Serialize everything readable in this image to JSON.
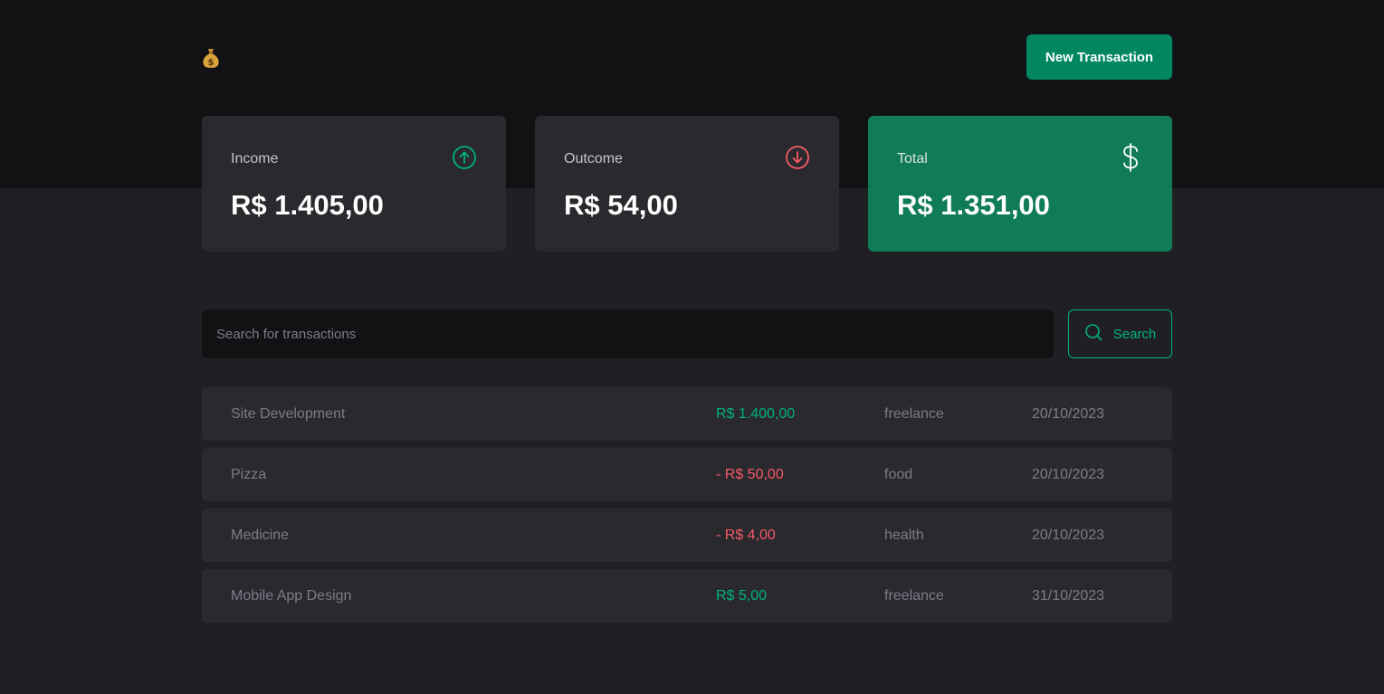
{
  "header": {
    "logo_icon": "money-bag-icon",
    "new_transaction_label": "New Transaction"
  },
  "summary": {
    "income": {
      "label": "Income",
      "value": "R$ 1.405,00",
      "icon": "arrow-circle-up-icon",
      "icon_color": "#00b37e"
    },
    "outcome": {
      "label": "Outcome",
      "value": "R$ 54,00",
      "icon": "arrow-circle-down-icon",
      "icon_color": "#f75a68"
    },
    "total": {
      "label": "Total",
      "value": "R$ 1.351,00",
      "icon": "dollar-sign-icon",
      "bg_color": "#0f7b57"
    }
  },
  "search": {
    "placeholder": "Search for transactions",
    "value": "",
    "button_label": "Search"
  },
  "transactions": [
    {
      "description": "Site Development",
      "price": "R$ 1.400,00",
      "type": "income",
      "category": "freelance",
      "date": "20/10/2023"
    },
    {
      "description": "Pizza",
      "price": "- R$ 50,00",
      "type": "outcome",
      "category": "food",
      "date": "20/10/2023"
    },
    {
      "description": "Medicine",
      "price": "- R$ 4,00",
      "type": "outcome",
      "category": "health",
      "date": "20/10/2023"
    },
    {
      "description": "Mobile App Design",
      "price": "R$ 5,00",
      "type": "income",
      "category": "freelance",
      "date": "31/10/2023"
    }
  ],
  "colors": {
    "brand": "#00875f",
    "income": "#00b37e",
    "outcome": "#f75a68"
  }
}
